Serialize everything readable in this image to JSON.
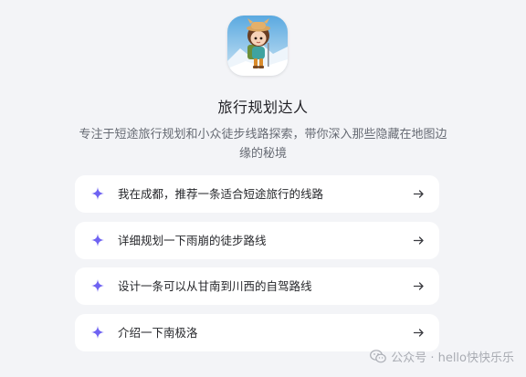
{
  "agent": {
    "name": "旅行规划达人",
    "description": "专注于短途旅行规划和小众徒步线路探索，带你深入那些隐藏在地图边缘的秘境",
    "avatar_icon": "hiker-character-avatar"
  },
  "suggestions": [
    {
      "label": "我在成都，推荐一条适合短途旅行的线路",
      "icon": "sparkle-icon",
      "action_icon": "arrow-right-icon"
    },
    {
      "label": "详细规划一下雨崩的徒步路线",
      "icon": "sparkle-icon",
      "action_icon": "arrow-right-icon"
    },
    {
      "label": "设计一条可以从甘南到川西的自驾路线",
      "icon": "sparkle-icon",
      "action_icon": "arrow-right-icon"
    },
    {
      "label": "介绍一下南极洛",
      "icon": "sparkle-icon",
      "action_icon": "arrow-right-icon"
    }
  ],
  "watermark": {
    "text": "公众号 · hello快快乐乐",
    "icon": "wechat-icon"
  },
  "colors": {
    "background": "#f3f4f7",
    "card": "#ffffff",
    "accent": "#6f63f2",
    "text_primary": "#1f1f24",
    "text_secondary": "#666a73"
  }
}
